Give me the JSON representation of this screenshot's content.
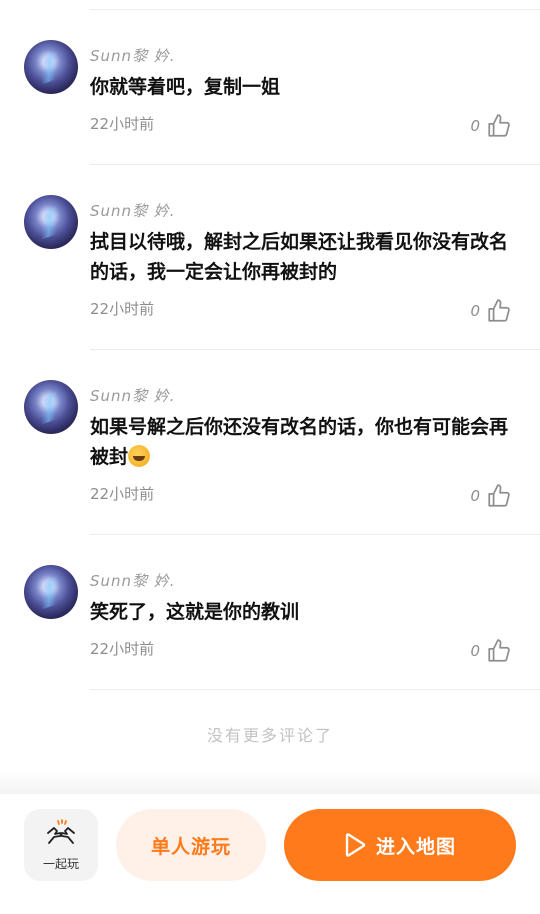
{
  "comments": [
    {
      "username": "Sunn黎  妗.",
      "text": "你就等着吧，复制一姐",
      "time": "22小时前",
      "likes": "0"
    },
    {
      "username": "Sunn黎  妗.",
      "text": "拭目以待哦，解封之后如果还让我看见你没有改名的话，我一定会让你再被封的",
      "time": "22小时前",
      "likes": "0"
    },
    {
      "username": "Sunn黎  妗.",
      "text": "如果号解之后你还没有改名的话，你也有可能会再被封",
      "time": "22小时前",
      "likes": "0"
    },
    {
      "username": "Sunn黎  妗.",
      "text": "笑死了，这就是你的教训",
      "time": "22小时前",
      "likes": "0"
    }
  ],
  "no_more_text": "没有更多评论了",
  "bottom_bar": {
    "play_together_label": "一起玩",
    "solo_label": "单人游玩",
    "enter_label": "进入地图"
  },
  "colors": {
    "accent": "#ff7a1a",
    "accent_light": "#fff0e8"
  },
  "icons": {
    "like": "thumbs-up-icon",
    "play_together": "hands-icon",
    "enter": "play-icon"
  }
}
